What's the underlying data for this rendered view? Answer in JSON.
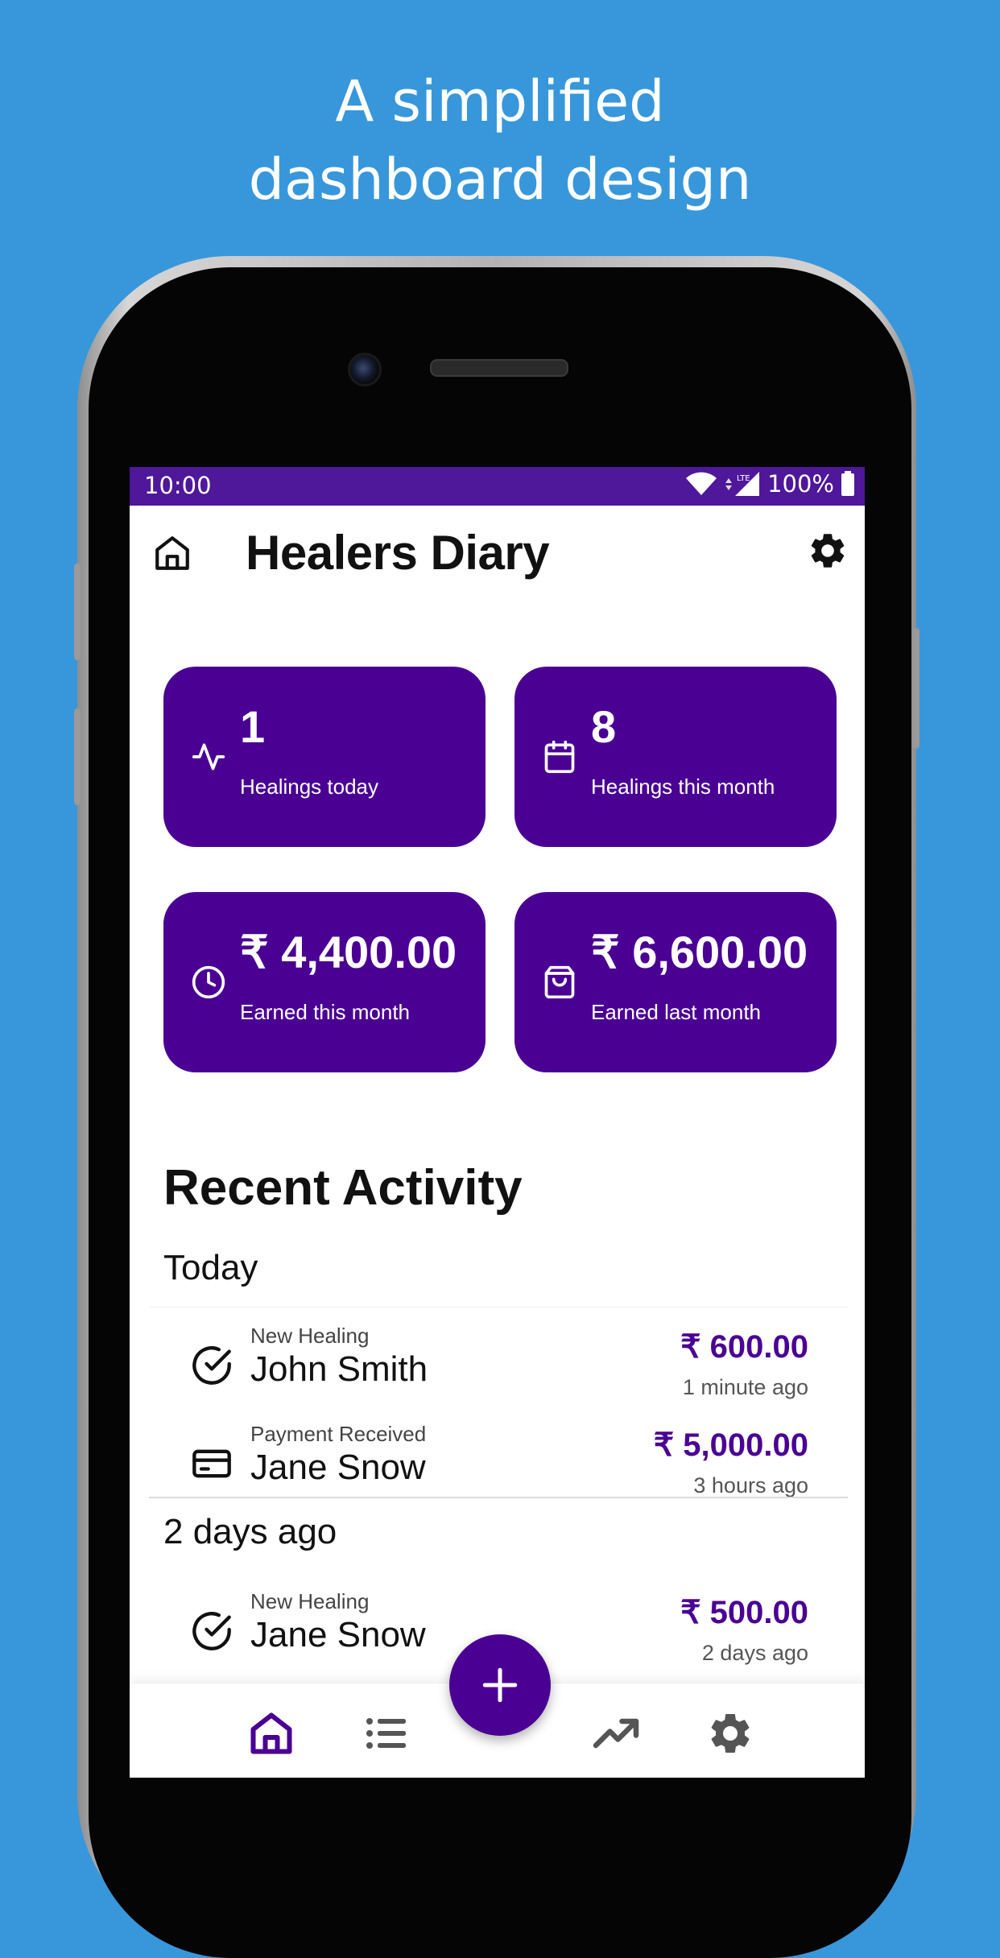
{
  "headline": {
    "line1": "A simplified",
    "line2": "dashboard design"
  },
  "status_bar": {
    "time": "10:00",
    "network": "LTE",
    "battery": "100%"
  },
  "app_bar": {
    "title": "Healers Diary",
    "home_icon": "home-icon",
    "settings_icon": "gear-icon"
  },
  "stats": [
    {
      "value": "1",
      "label": "Healings today",
      "icon": "activity-icon"
    },
    {
      "value": "8",
      "label": "Healings this month",
      "icon": "calendar-icon"
    },
    {
      "value": "₹ 4,400.00",
      "label": "Earned this month",
      "icon": "clock-icon"
    },
    {
      "value": "₹ 6,600.00",
      "label": "Earned last month",
      "icon": "shopping-bag-icon"
    }
  ],
  "recent_activity": {
    "title": "Recent Activity",
    "groups": [
      {
        "title": "Today",
        "items": [
          {
            "type": "New Healing",
            "name": "John Smith",
            "amount": "₹ 600.00",
            "time": "1 minute ago",
            "icon": "check-circle-icon"
          },
          {
            "type": "Payment Received",
            "name": "Jane Snow",
            "amount": "₹ 5,000.00",
            "time": "3 hours ago",
            "icon": "credit-card-icon"
          }
        ]
      },
      {
        "title": "2 days ago",
        "items": [
          {
            "type": "New Healing",
            "name": "Jane Snow",
            "amount": "₹ 500.00",
            "time": "2 days ago",
            "icon": "check-circle-icon"
          }
        ]
      }
    ]
  },
  "bottom_nav": [
    "home-icon",
    "list-icon",
    "trending-up-icon",
    "gear-icon"
  ],
  "colors": {
    "background": "#3897DB",
    "primary": "#4A0093",
    "status_bar": "#4F1799",
    "nav_active": "#4A0093",
    "nav_inactive": "#555555"
  }
}
